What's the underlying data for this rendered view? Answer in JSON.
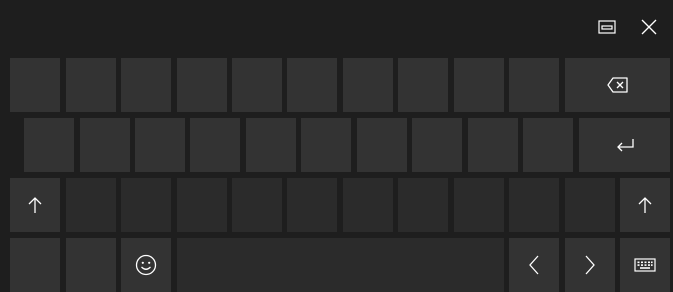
{
  "titlebar": {
    "buttons": [
      {
        "id": "dock",
        "icon": "dock-undock-icon"
      },
      {
        "id": "close",
        "icon": "close-icon"
      }
    ]
  },
  "rows": [
    {
      "name": "row-1",
      "keys": [
        "",
        "",
        "",
        "",
        "",
        "",
        "",
        "",
        "",
        "",
        "backspace"
      ]
    },
    {
      "name": "row-2",
      "keys": [
        "",
        "",
        "",
        "",
        "",
        "",
        "",
        "",
        "",
        "",
        "enter"
      ]
    },
    {
      "name": "row-3",
      "keys": [
        "shift",
        "",
        "",
        "",
        "",
        "",
        "",
        "",
        "",
        "",
        "",
        "shift"
      ]
    },
    {
      "name": "row-4",
      "keys": [
        "",
        "",
        "emoji",
        "space",
        "left-arrow",
        "right-arrow",
        "keyboard-menu"
      ]
    }
  ],
  "icons": {
    "backspace": "backspace-icon",
    "enter": "enter-icon",
    "shift": "shift-arrow-icon",
    "emoji": "emoji-smiley-icon",
    "left": "left-arrow-icon",
    "right": "right-arrow-icon",
    "keyboard": "keyboard-icon"
  },
  "colors": {
    "background": "#1e1e1e",
    "key": "#333333",
    "key_dark": "#2b2b2b",
    "glyph": "#ffffff"
  }
}
